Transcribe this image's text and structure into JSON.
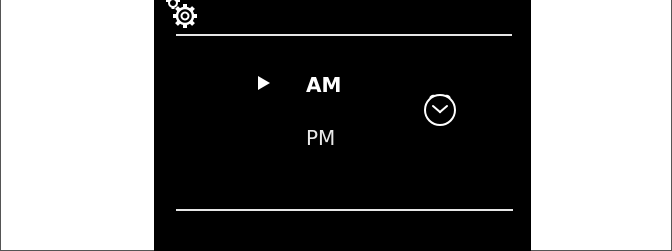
{
  "screen": {
    "header": {
      "icon": "settings-gear-icon"
    },
    "options": [
      {
        "label": "AM",
        "selected": true
      },
      {
        "label": "PM",
        "selected": false
      }
    ],
    "selector_icon": "play-arrow-icon",
    "side_icon": "clock-icon",
    "colors": {
      "background": "#000000",
      "foreground": "#ffffff",
      "divider": "#e6e6e6"
    }
  }
}
